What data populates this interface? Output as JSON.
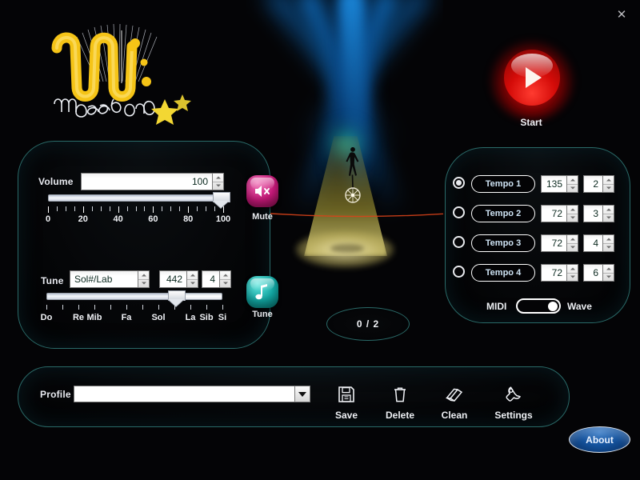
{
  "window": {
    "close_label": "✕"
  },
  "logo": {
    "brand": "maestro"
  },
  "start": {
    "label": "Start",
    "icon": "play-icon"
  },
  "counter": {
    "value": "0 / 2"
  },
  "volume": {
    "label": "Volume",
    "value": "100",
    "slider_percent": 100,
    "scale_labels": [
      "0",
      "20",
      "40",
      "60",
      "80",
      "100"
    ],
    "tick_count": 21
  },
  "mute": {
    "label": "Mute",
    "icon": "speaker-mute-icon",
    "color": "#c8197a"
  },
  "tune": {
    "label": "Tune",
    "button_label": "Tune",
    "icon": "music-note-icon",
    "color": "#12a8a4",
    "note_value": "Sol#/Lab",
    "frequency_value": "442",
    "octave_value": "4",
    "slider_percent": 66.7,
    "tick_count": 12,
    "scale_labels": [
      "Do",
      "Re",
      "Mib",
      "Fa",
      "Sol",
      "La",
      "Sib",
      "Si"
    ]
  },
  "tempo": {
    "rows": [
      {
        "label": "Tempo 1",
        "bpm": "135",
        "beats": "2",
        "selected": true
      },
      {
        "label": "Tempo 2",
        "bpm": "72",
        "beats": "3",
        "selected": false
      },
      {
        "label": "Tempo 3",
        "bpm": "72",
        "beats": "4",
        "selected": false
      },
      {
        "label": "Tempo 4",
        "bpm": "72",
        "beats": "6",
        "selected": false
      }
    ],
    "toggle": {
      "left_label": "MIDI",
      "right_label": "Wave",
      "position": "right"
    }
  },
  "profile": {
    "label": "Profile",
    "value": "",
    "placeholder": ""
  },
  "actions": [
    {
      "label": "Save",
      "icon": "floppy-disk-icon"
    },
    {
      "label": "Delete",
      "icon": "trash-can-icon"
    },
    {
      "label": "Clean",
      "icon": "eraser-icon"
    },
    {
      "label": "Settings",
      "icon": "wrench-icon"
    }
  ],
  "about": {
    "label": "About"
  },
  "colors": {
    "panel_border": "#2a6a68",
    "background": "#040406",
    "accent_mute": "#c8197a",
    "accent_tune": "#12a8a4",
    "accent_start": "#d40b08",
    "accent_about": "#14539e",
    "logo_gold": "#f5c417"
  }
}
